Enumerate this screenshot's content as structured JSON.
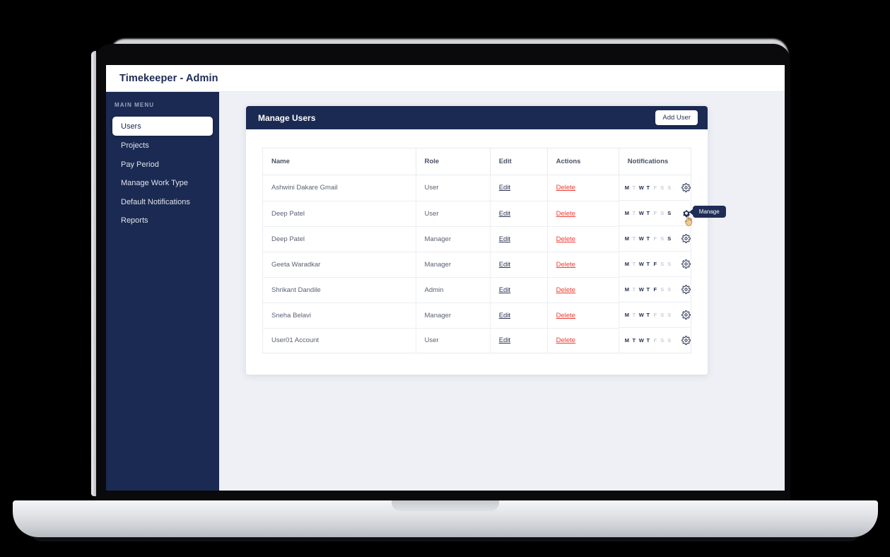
{
  "app": {
    "title": "Timekeeper - Admin"
  },
  "sidebar": {
    "caption": "MAIN MENU",
    "items": [
      {
        "label": "Users",
        "active": true
      },
      {
        "label": "Projects",
        "active": false
      },
      {
        "label": "Pay Period",
        "active": false
      },
      {
        "label": "Manage Work Type",
        "active": false
      },
      {
        "label": "Default Notifications",
        "active": false
      },
      {
        "label": "Reports",
        "active": false
      }
    ]
  },
  "card": {
    "title": "Manage Users",
    "add_user_label": "Add User"
  },
  "table": {
    "columns": [
      "Name",
      "Role",
      "Edit",
      "Actions",
      "Notifications"
    ],
    "edit_label": "Edit",
    "delete_label": "Delete",
    "day_letters": [
      "M",
      "T",
      "W",
      "T",
      "F",
      "S",
      "S"
    ],
    "gear_icon": "gear-icon",
    "rows": [
      {
        "name": "Ashwini Dakare Gmail",
        "role": "User",
        "days": [
          true,
          false,
          true,
          true,
          false,
          false,
          false
        ],
        "hovered": false
      },
      {
        "name": "Deep Patel",
        "role": "User",
        "days": [
          true,
          false,
          true,
          true,
          false,
          false,
          true
        ],
        "hovered": true
      },
      {
        "name": "Deep Patel",
        "role": "Manager",
        "days": [
          true,
          false,
          true,
          true,
          false,
          false,
          true
        ],
        "hovered": false
      },
      {
        "name": "Geeta Waradkar",
        "role": "Manager",
        "days": [
          true,
          false,
          true,
          true,
          true,
          false,
          false
        ],
        "hovered": false
      },
      {
        "name": "Shrikant Dandile",
        "role": "Admin",
        "days": [
          true,
          false,
          true,
          true,
          true,
          false,
          false
        ],
        "hovered": false
      },
      {
        "name": "Sneha Belavi",
        "role": "Manager",
        "days": [
          true,
          false,
          true,
          true,
          false,
          false,
          false
        ],
        "hovered": false
      },
      {
        "name": "User01 Account",
        "role": "User",
        "days": [
          true,
          true,
          true,
          true,
          false,
          false,
          false
        ],
        "hovered": false
      }
    ]
  },
  "tooltip": {
    "label": "Manage"
  },
  "colors": {
    "navy": "#1b2a52",
    "page_bg": "#eef0f5",
    "delete_red": "#ee3b33",
    "day_on": "#262f4d",
    "day_off": "#c9cdd8"
  }
}
